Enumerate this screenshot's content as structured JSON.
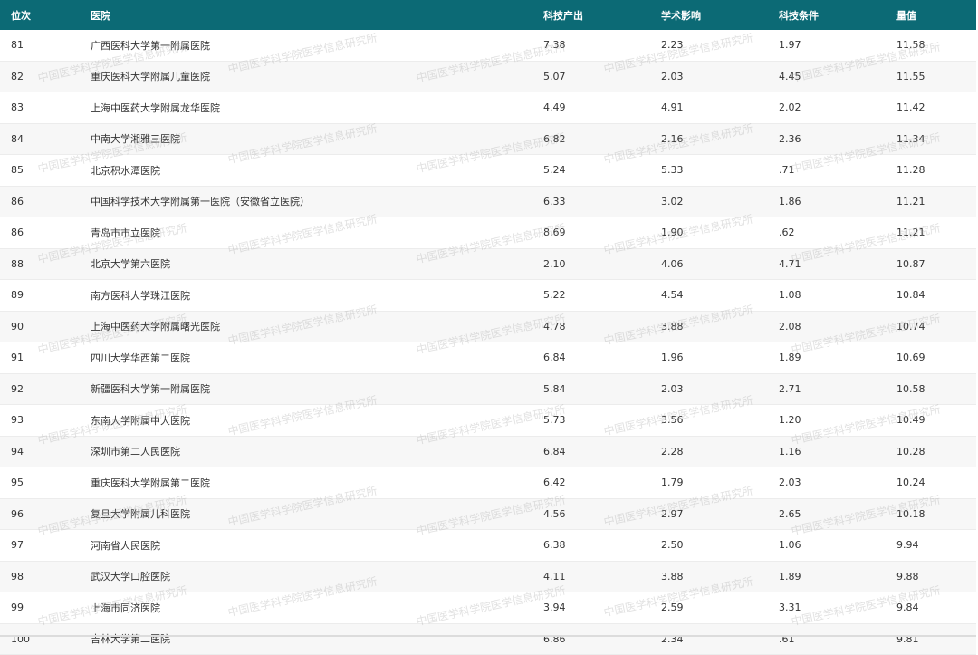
{
  "table": {
    "headers": {
      "rank": "位次",
      "hospital": "医院",
      "output": "科技产出",
      "influence": "学术影响",
      "conditions": "科技条件",
      "score": "量值"
    },
    "rows": [
      {
        "rank": "81",
        "hospital": "广西医科大学第一附属医院",
        "output": "7.38",
        "influence": "2.23",
        "conditions": "1.97",
        "score": "11.58"
      },
      {
        "rank": "82",
        "hospital": "重庆医科大学附属儿童医院",
        "output": "5.07",
        "influence": "2.03",
        "conditions": "4.45",
        "score": "11.55"
      },
      {
        "rank": "83",
        "hospital": "上海中医药大学附属龙华医院",
        "output": "4.49",
        "influence": "4.91",
        "conditions": "2.02",
        "score": "11.42"
      },
      {
        "rank": "84",
        "hospital": "中南大学湘雅三医院",
        "output": "6.82",
        "influence": "2.16",
        "conditions": "2.36",
        "score": "11.34"
      },
      {
        "rank": "85",
        "hospital": "北京积水潭医院",
        "output": "5.24",
        "influence": "5.33",
        "conditions": ".71",
        "score": "11.28"
      },
      {
        "rank": "86",
        "hospital": "中国科学技术大学附属第一医院（安徽省立医院）",
        "output": "6.33",
        "influence": "3.02",
        "conditions": "1.86",
        "score": "11.21"
      },
      {
        "rank": "86",
        "hospital": "青岛市市立医院",
        "output": "8.69",
        "influence": "1.90",
        "conditions": ".62",
        "score": "11.21"
      },
      {
        "rank": "88",
        "hospital": "北京大学第六医院",
        "output": "2.10",
        "influence": "4.06",
        "conditions": "4.71",
        "score": "10.87"
      },
      {
        "rank": "89",
        "hospital": "南方医科大学珠江医院",
        "output": "5.22",
        "influence": "4.54",
        "conditions": "1.08",
        "score": "10.84"
      },
      {
        "rank": "90",
        "hospital": "上海中医药大学附属曙光医院",
        "output": "4.78",
        "influence": "3.88",
        "conditions": "2.08",
        "score": "10.74"
      },
      {
        "rank": "91",
        "hospital": "四川大学华西第二医院",
        "output": "6.84",
        "influence": "1.96",
        "conditions": "1.89",
        "score": "10.69"
      },
      {
        "rank": "92",
        "hospital": "新疆医科大学第一附属医院",
        "output": "5.84",
        "influence": "2.03",
        "conditions": "2.71",
        "score": "10.58"
      },
      {
        "rank": "93",
        "hospital": "东南大学附属中大医院",
        "output": "5.73",
        "influence": "3.56",
        "conditions": "1.20",
        "score": "10.49"
      },
      {
        "rank": "94",
        "hospital": "深圳市第二人民医院",
        "output": "6.84",
        "influence": "2.28",
        "conditions": "1.16",
        "score": "10.28"
      },
      {
        "rank": "95",
        "hospital": "重庆医科大学附属第二医院",
        "output": "6.42",
        "influence": "1.79",
        "conditions": "2.03",
        "score": "10.24"
      },
      {
        "rank": "96",
        "hospital": "复旦大学附属儿科医院",
        "output": "4.56",
        "influence": "2.97",
        "conditions": "2.65",
        "score": "10.18"
      },
      {
        "rank": "97",
        "hospital": "河南省人民医院",
        "output": "6.38",
        "influence": "2.50",
        "conditions": "1.06",
        "score": "9.94"
      },
      {
        "rank": "98",
        "hospital": "武汉大学口腔医院",
        "output": "4.11",
        "influence": "3.88",
        "conditions": "1.89",
        "score": "9.88"
      },
      {
        "rank": "99",
        "hospital": "上海市同济医院",
        "output": "3.94",
        "influence": "2.59",
        "conditions": "3.31",
        "score": "9.84"
      },
      {
        "rank": "100",
        "hospital": "吉林大学第二医院",
        "output": "6.86",
        "influence": "2.34",
        "conditions": ".61",
        "score": "9.81"
      }
    ]
  },
  "watermark": {
    "text": "中国医学科学院医学信息研究所"
  },
  "colors": {
    "header_bg": "#0c6a75",
    "header_text": "#ffffff",
    "stripe": "#f7f7f7"
  }
}
